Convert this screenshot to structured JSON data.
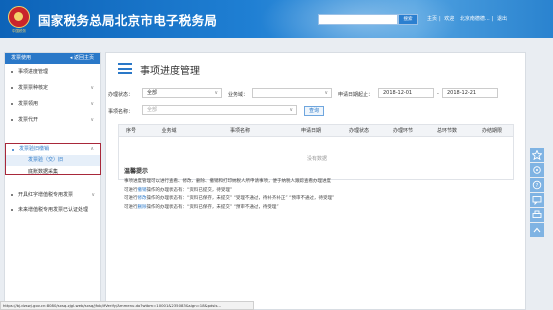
{
  "header": {
    "logo_caption": "中国税务",
    "site_title": "国家税务总局北京市电子税务局",
    "search_button": "搜索",
    "links": [
      "主页",
      "欢迎",
      "北京南德德...",
      "退出"
    ]
  },
  "sidebar": {
    "title": "发票使用",
    "back": "返回主页",
    "items": [
      {
        "label": "事项进度管理"
      },
      {
        "label": "发票票种核定"
      },
      {
        "label": "发票领用"
      },
      {
        "label": "发票代开"
      },
      {
        "label": "发票验旧缴销"
      },
      {
        "label": "开具红字增值税专用发票"
      },
      {
        "label": "未来增值税专用发票已认证处理"
      }
    ],
    "sub_items": [
      "发票验（交）旧",
      "底账数据采集"
    ]
  },
  "main": {
    "title": "事项进度管理",
    "filters": {
      "status_label": "办理状态：",
      "status_value": "全部",
      "business_label": "业务域：",
      "business_value": "",
      "date_label": "申请日期起止：",
      "date_from": "2018-12-01",
      "date_sep": "-",
      "date_to": "2018-12-21",
      "name_label": "事项名称：",
      "name_value": "全部",
      "query_button": "查询"
    },
    "table": {
      "headers": [
        "序号",
        "业务域",
        "事项名称",
        "申请日期",
        "办理状态",
        "办理环节",
        "总环节数",
        "办结期限"
      ],
      "empty_text": "没有数据"
    },
    "tips": {
      "title": "温馨提示",
      "lines": [
        {
          "pre": "事项进度管理可以进行查看、修改、删除、撤销和打印纳税人所申请事项，便于纳税人跟踪查看办理进度",
          "hl": "",
          "post": ""
        },
        {
          "pre": "可进行",
          "hl": "撤销",
          "post": "操作的办理状态有：“资料已提交，待受理”"
        },
        {
          "pre": "可进行",
          "hl": "修改",
          "post": "操作的办理状态有：“资料已保存，未提交” “受理不通过，待补齐补正” “预审不通过，待受理”"
        },
        {
          "pre": "可进行",
          "hl": "删除",
          "post": "操作的办理状态有：“资料已保存，未提交” “预审不通过，待受理”"
        }
      ]
    }
  },
  "statusbar": {
    "url": "https://bj.dzswj.gov.cn:8080/sxsq-zjgl-web/sxsq/jfxb/ifVerify/Ammenu.do?wtbm=10001&235083&sign=18&pdsls..."
  },
  "tools": [
    "star-icon",
    "refresh-icon",
    "help-icon",
    "message-icon",
    "print-icon",
    "back-to-top-icon"
  ]
}
